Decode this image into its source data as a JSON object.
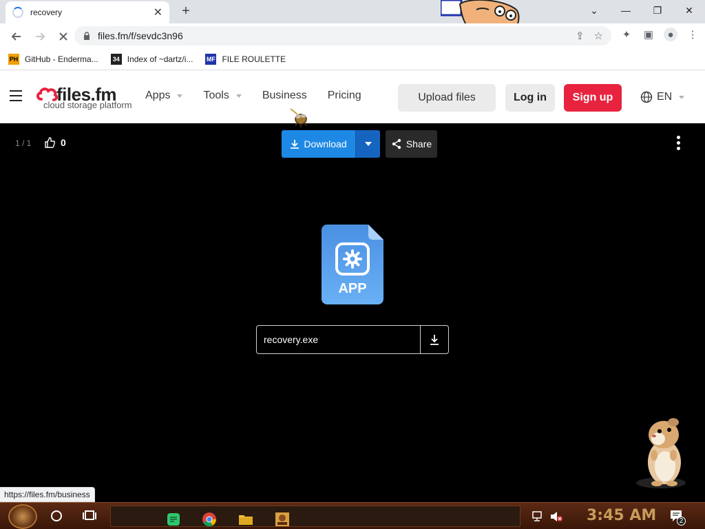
{
  "browser": {
    "tab_title": "recovery",
    "url": "files.fm/f/sevdc3n96",
    "bookmarks": [
      {
        "label": "GitHub - Enderma...",
        "icon": "PH",
        "icon_bg": "#f0a000",
        "icon_fg": "#000000"
      },
      {
        "label": "Index of ~dartz/i...",
        "icon": "34",
        "icon_bg": "#222222",
        "icon_fg": "#ffffff"
      },
      {
        "label": "FILE ROULETTE",
        "icon": "MF",
        "icon_bg": "#2233aa",
        "icon_fg": "#ffffff"
      }
    ]
  },
  "site": {
    "logo_main": "files.fm",
    "logo_sub": "cloud storage platform",
    "brand_color": "#e8233f",
    "nav": {
      "apps": "Apps",
      "tools": "Tools",
      "business": "Business",
      "pricing": "Pricing"
    },
    "upload_label": "Upload files",
    "login_label": "Log in",
    "signup_label": "Sign up",
    "lang": "EN"
  },
  "viewer": {
    "counter": "1 / 1",
    "likes": "0",
    "download_label": "Download",
    "share_label": "Share",
    "file_type": "APP",
    "filename": "recovery.exe"
  },
  "status_url": "https://files.fm/business",
  "taskbar": {
    "time": "3:45 AM",
    "notification_count": "2"
  }
}
